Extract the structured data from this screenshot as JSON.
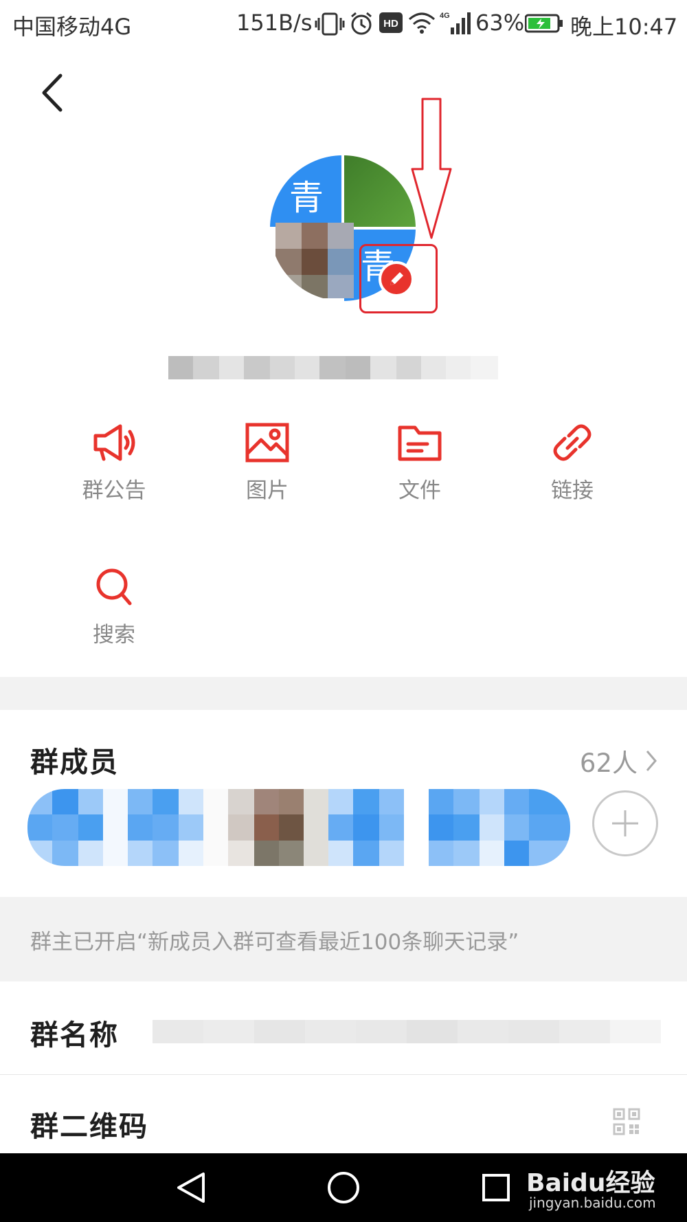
{
  "status_bar": {
    "carrier": "中国移动4G",
    "net_speed": "151B/s",
    "signal_type": "4G",
    "battery": "63%",
    "time": "晚上10:47"
  },
  "header": {
    "back_icon": "chevron-left-icon"
  },
  "avatar": {
    "tile_char_1": "青",
    "tile_char_2": "青",
    "edit_icon": "pencil-icon",
    "accent": "#e8332c",
    "tile_blue": "#2f8ff2"
  },
  "actions": [
    {
      "label": "群公告",
      "icon": "megaphone-icon"
    },
    {
      "label": "图片",
      "icon": "image-icon"
    },
    {
      "label": "文件",
      "icon": "folder-icon"
    },
    {
      "label": "链接",
      "icon": "link-icon"
    },
    {
      "label": "搜索",
      "icon": "search-icon"
    }
  ],
  "members": {
    "title": "群成员",
    "count": "62人",
    "add_icon": "plus-icon"
  },
  "notice": {
    "text": "群主已开启“新成员入群可查看最近100条聊天记录”"
  },
  "group_name": {
    "label": "群名称"
  },
  "group_qr": {
    "label": "群二维码",
    "icon": "qr-code-icon"
  },
  "nav": {
    "back": "triangle-back-icon",
    "home": "circle-home-icon",
    "recents": "square-recents-icon"
  },
  "watermark": {
    "brand": "Baidu经验",
    "url": "jingyan.baidu.com"
  }
}
